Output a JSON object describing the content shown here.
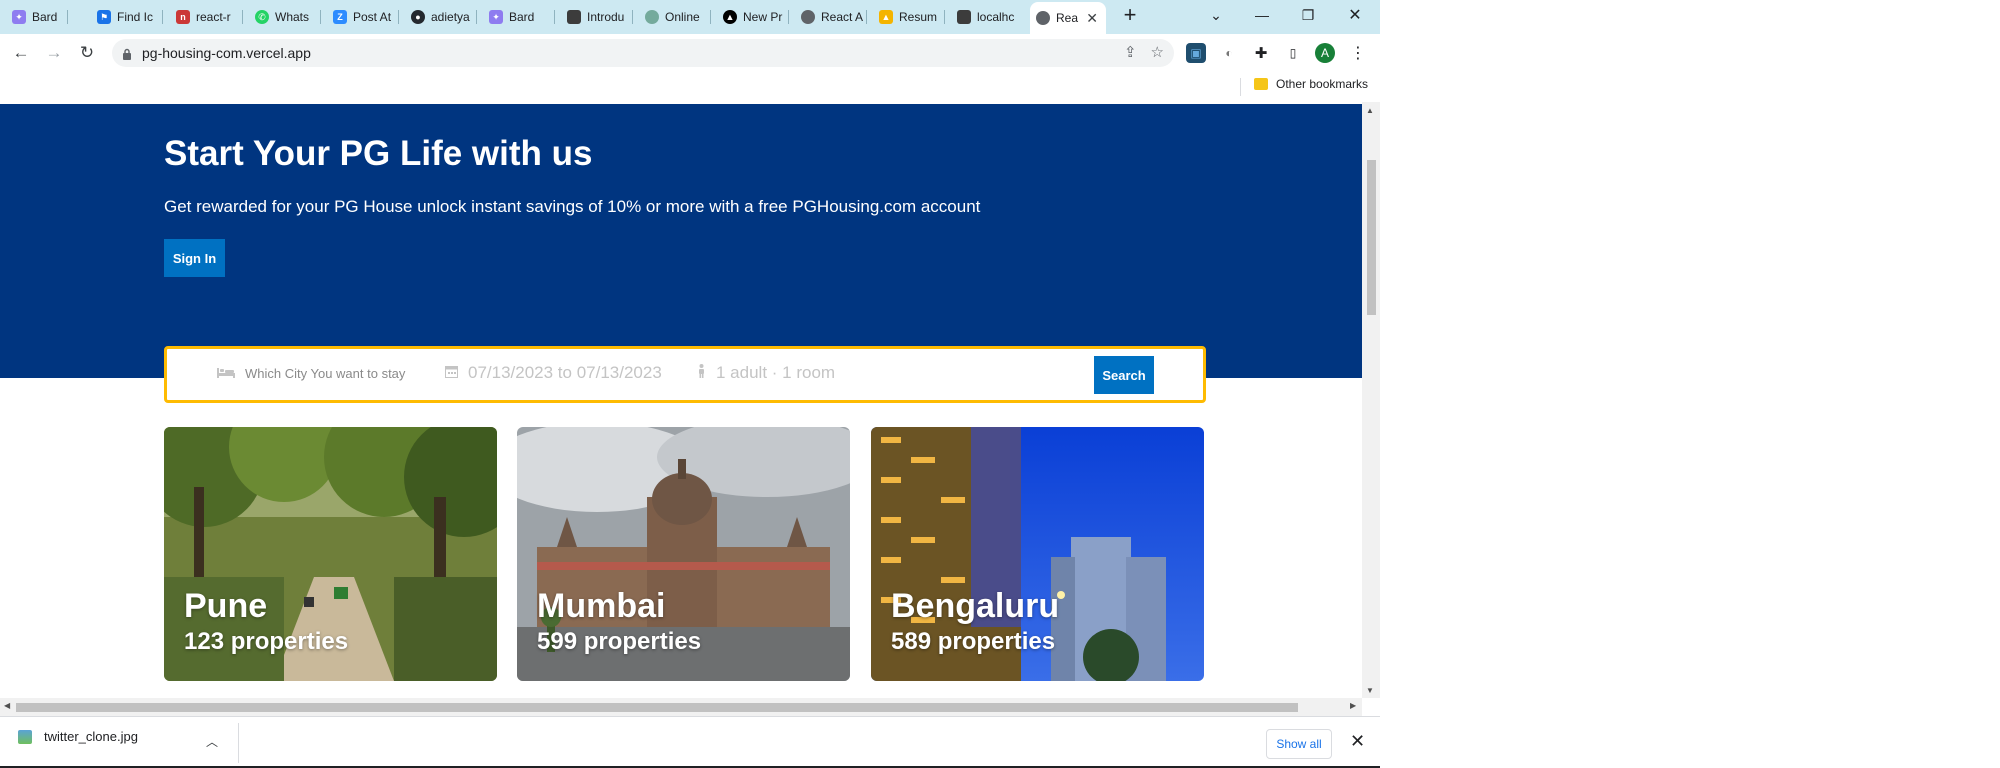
{
  "browser": {
    "tabs": [
      {
        "label": "Bard",
        "icon": "bard-icon",
        "color": "#8e7cf0"
      },
      {
        "label": "Find Ic",
        "icon": "flag-icon",
        "color": "#1a73e8"
      },
      {
        "label": "react-r",
        "icon": "npm-icon",
        "color": "#cb3837"
      },
      {
        "label": "Whats",
        "icon": "whatsapp-icon",
        "color": "#25d366"
      },
      {
        "label": "Post At",
        "icon": "zoom-icon",
        "color": "#2d8cff"
      },
      {
        "label": "adietya",
        "icon": "github-icon",
        "color": "#24292f"
      },
      {
        "label": "Bard",
        "icon": "bard-icon",
        "color": "#8e7cf0"
      },
      {
        "label": "Introdu",
        "icon": "site-icon",
        "color": "#3c3c3c"
      },
      {
        "label": "Online",
        "icon": "chatgpt-icon",
        "color": "#74aa9c"
      },
      {
        "label": "New Pr",
        "icon": "vercel-icon",
        "color": "#000000"
      },
      {
        "label": "React A",
        "icon": "globe-icon",
        "color": "#5f6368"
      },
      {
        "label": "Resum",
        "icon": "drive-icon",
        "color": "#f4b400"
      },
      {
        "label": "localhc",
        "icon": "site-icon",
        "color": "#3c3c3c"
      },
      {
        "label": "Rea",
        "icon": "globe-icon",
        "color": "#5f6368"
      }
    ],
    "url": "pg-housing-com.vercel.app",
    "bookmarks": {
      "folder_label": "Other bookmarks"
    },
    "profile_initial": "A"
  },
  "hero": {
    "title": "Start Your PG Life with us",
    "subtitle": "Get rewarded for your PG House unlock instant savings of 10% or more with a free PGHousing.com account",
    "signin_label": "Sign In"
  },
  "search": {
    "city_placeholder": "Which City You want to stay",
    "dates": "07/13/2023 to 07/13/2023",
    "guests": "1 adult · 1 room",
    "button_label": "Search"
  },
  "cities": [
    {
      "name": "Pune",
      "properties": "123 properties"
    },
    {
      "name": "Mumbai",
      "properties": "599 properties"
    },
    {
      "name": "Bengaluru",
      "properties": "589 properties"
    }
  ],
  "downloads": {
    "file_name": "twitter_clone.jpg",
    "show_all_label": "Show all"
  },
  "colors": {
    "hero_bg": "#003580",
    "primary_button": "#0071c2",
    "search_border": "#febb02",
    "tabstrip_bg": "#cde9f2"
  }
}
